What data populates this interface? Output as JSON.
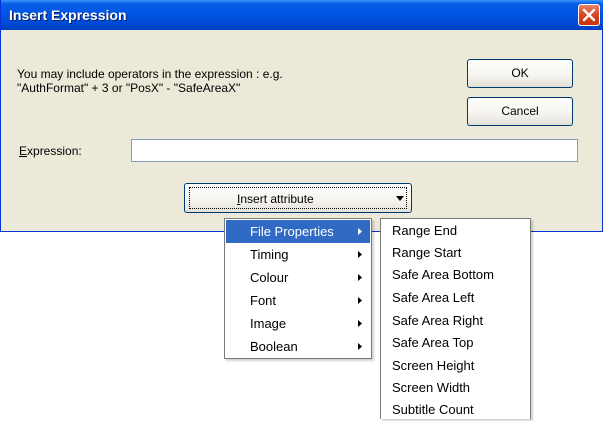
{
  "window": {
    "title": "Insert Expression",
    "close_icon": "close-icon"
  },
  "prompt": {
    "text": "You may include operators in the expression : e.g.\n\"AuthFormat\" + 3 or \"PosX\" - \"SafeAreaX\""
  },
  "buttons": {
    "ok": "OK",
    "cancel": "Cancel"
  },
  "expression": {
    "label_mnemonic": "E",
    "label_rest": "xpression:",
    "value": ""
  },
  "insert_attribute": {
    "label_mnemonic": "I",
    "label_rest": "nsert attribute",
    "arrow_icon": "dropdown-arrow-icon"
  },
  "menu": {
    "items": [
      {
        "label": "File Properties",
        "selected": true
      },
      {
        "label": "Timing"
      },
      {
        "label": "Colour"
      },
      {
        "label": "Font"
      },
      {
        "label": "Image"
      },
      {
        "label": "Boolean"
      }
    ]
  },
  "submenu": {
    "items": [
      {
        "label": "Range End"
      },
      {
        "label": "Range Start"
      },
      {
        "label": "Safe Area Bottom"
      },
      {
        "label": "Safe Area Left"
      },
      {
        "label": "Safe Area Right"
      },
      {
        "label": "Safe Area Top"
      },
      {
        "label": "Screen Height"
      },
      {
        "label": "Screen Width"
      },
      {
        "label": "Subtitle Count"
      }
    ]
  },
  "colors": {
    "titlebar": "#0055e5",
    "dialog_bg": "#ece9d8",
    "menu_highlight": "#316ac5",
    "close_button": "#d9441f"
  }
}
